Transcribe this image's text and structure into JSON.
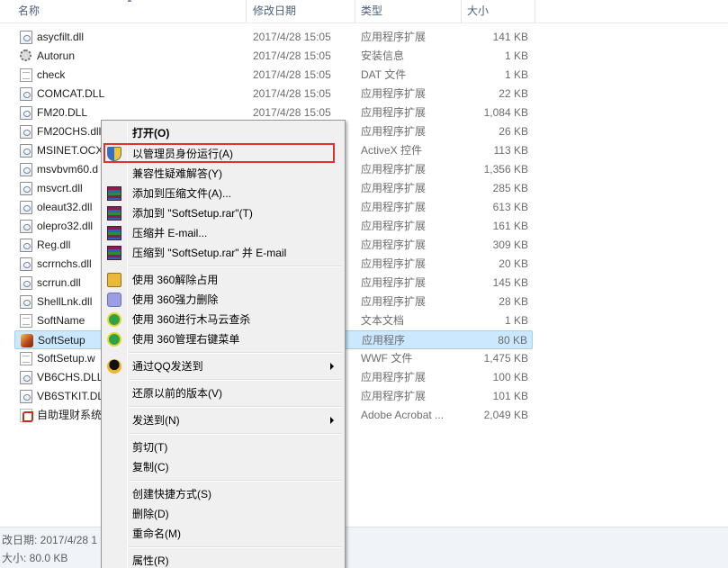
{
  "columns": {
    "name": "名称",
    "date": "修改日期",
    "type": "类型",
    "size": "大小"
  },
  "files": [
    {
      "name": "asycfilt.dll",
      "date": "2017/4/28 15:05",
      "type": "应用程序扩展",
      "size": "141 KB",
      "icon": "dll-icon"
    },
    {
      "name": "Autorun",
      "date": "2017/4/28 15:05",
      "type": "安装信息",
      "size": "1 KB",
      "icon": "settings-file-icon"
    },
    {
      "name": "check",
      "date": "2017/4/28 15:05",
      "type": "DAT 文件",
      "size": "1 KB",
      "icon": "document-icon"
    },
    {
      "name": "COMCAT.DLL",
      "date": "2017/4/28 15:05",
      "type": "应用程序扩展",
      "size": "22 KB",
      "icon": "dll-icon"
    },
    {
      "name": "FM20.DLL",
      "date": "2017/4/28 15:05",
      "type": "应用程序扩展",
      "size": "1,084 KB",
      "icon": "dll-icon"
    },
    {
      "name": "FM20CHS.dll",
      "date": "",
      "type": "应用程序扩展",
      "size": "26 KB",
      "icon": "dll-icon"
    },
    {
      "name": "MSINET.OCX",
      "date": "",
      "type": "ActiveX 控件",
      "size": "113 KB",
      "icon": "dll-icon"
    },
    {
      "name": "msvbvm60.d",
      "date": "",
      "type": "应用程序扩展",
      "size": "1,356 KB",
      "icon": "dll-icon"
    },
    {
      "name": "msvcrt.dll",
      "date": "",
      "type": "应用程序扩展",
      "size": "285 KB",
      "icon": "dll-icon"
    },
    {
      "name": "oleaut32.dll",
      "date": "",
      "type": "应用程序扩展",
      "size": "613 KB",
      "icon": "dll-icon"
    },
    {
      "name": "olepro32.dll",
      "date": "",
      "type": "应用程序扩展",
      "size": "161 KB",
      "icon": "dll-icon"
    },
    {
      "name": "Reg.dll",
      "date": "",
      "type": "应用程序扩展",
      "size": "309 KB",
      "icon": "dll-icon"
    },
    {
      "name": "scrrnchs.dll",
      "date": "",
      "type": "应用程序扩展",
      "size": "20 KB",
      "icon": "dll-icon"
    },
    {
      "name": "scrrun.dll",
      "date": "",
      "type": "应用程序扩展",
      "size": "145 KB",
      "icon": "dll-icon"
    },
    {
      "name": "ShellLnk.dll",
      "date": "",
      "type": "应用程序扩展",
      "size": "28 KB",
      "icon": "dll-icon"
    },
    {
      "name": "SoftName",
      "date": "",
      "type": "文本文档",
      "size": "1 KB",
      "icon": "document-icon"
    },
    {
      "name": "SoftSetup",
      "date": "",
      "type": "应用程序",
      "size": "80 KB",
      "icon": "app-icon",
      "selected": true
    },
    {
      "name": "SoftSetup.w",
      "date": "",
      "type": "WWF 文件",
      "size": "1,475 KB",
      "icon": "document-icon"
    },
    {
      "name": "VB6CHS.DLL",
      "date": "",
      "type": "应用程序扩展",
      "size": "100 KB",
      "icon": "dll-icon"
    },
    {
      "name": "VB6STKIT.DL",
      "date": "",
      "type": "应用程序扩展",
      "size": "101 KB",
      "icon": "dll-icon"
    },
    {
      "name": "自助理财系统",
      "date": "",
      "type": "Adobe Acrobat ...",
      "size": "2,049 KB",
      "icon": "pdf-icon"
    }
  ],
  "status": {
    "line1": "改日期: 2017/4/28 1",
    "line2": "大小: 80.0 KB"
  },
  "context_menu": {
    "open": "打开(O)",
    "run_as_admin": "以管理员身份运行(A)",
    "compat": "兼容性疑难解答(Y)",
    "add_archive": "添加到压缩文件(A)...",
    "add_rar": "添加到 \"SoftSetup.rar\"(T)",
    "compress_email": "压缩并 E-mail...",
    "compress_rar_email": "压缩到 \"SoftSetup.rar\" 并 E-mail",
    "unlock_360": "使用 360解除占用",
    "force_delete_360": "使用 360强力删除",
    "scan_360": "使用 360进行木马云查杀",
    "manage_menu_360": "使用 360管理右键菜单",
    "send_qq": "通过QQ发送到",
    "restore": "还原以前的版本(V)",
    "send_to": "发送到(N)",
    "cut": "剪切(T)",
    "copy": "复制(C)",
    "shortcut": "创建快捷方式(S)",
    "delete": "删除(D)",
    "rename": "重命名(M)",
    "properties": "属性(R)"
  },
  "colors": {
    "selection": "#cce8ff",
    "highlight_border": "#e0322e",
    "menu_bg": "#f0f0f0"
  }
}
